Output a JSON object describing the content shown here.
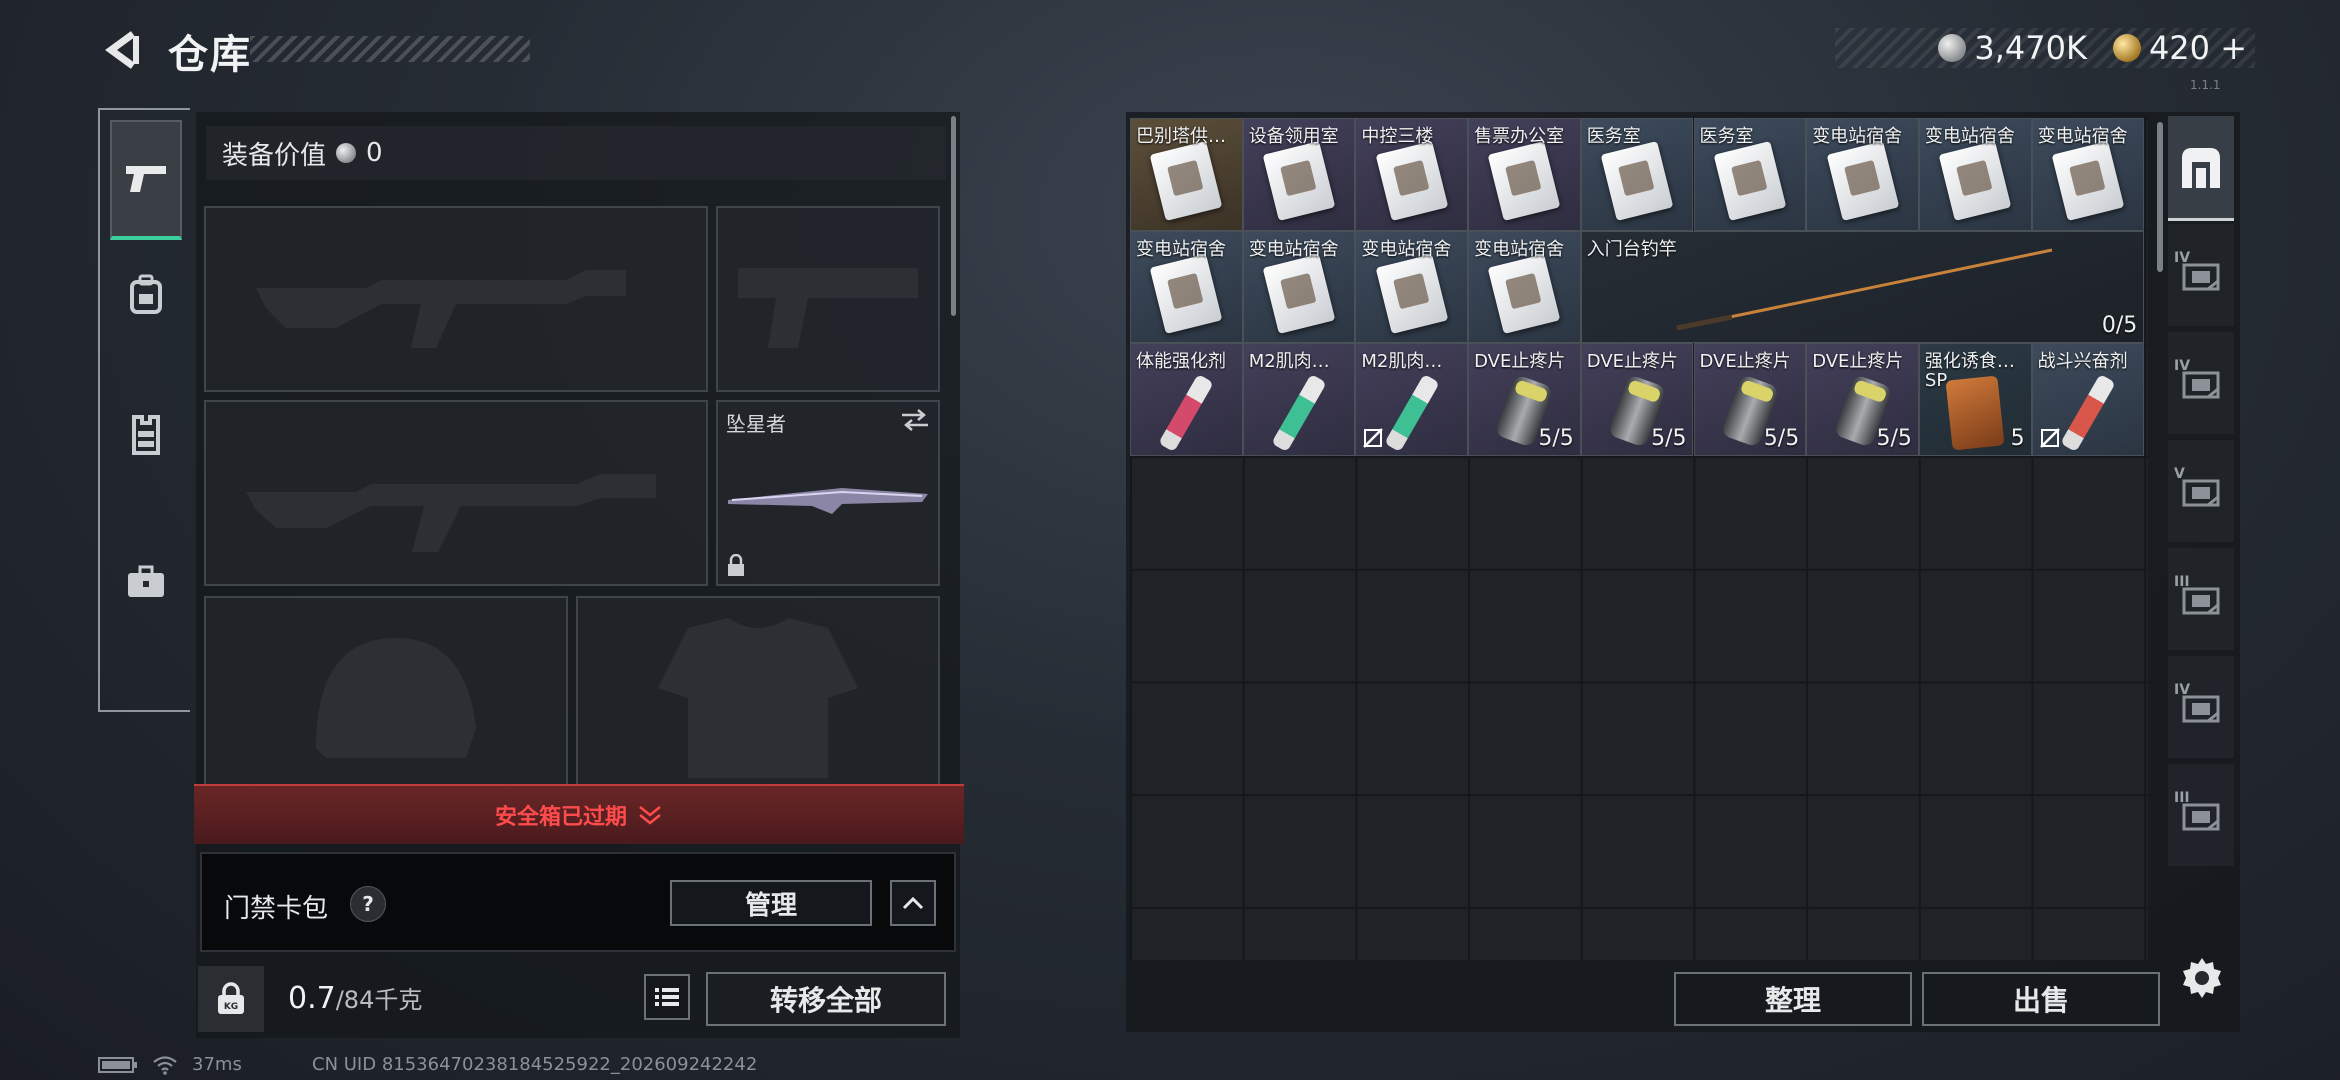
{
  "header": {
    "title": "仓库",
    "version_tag": "1.1.1"
  },
  "currency": [
    {
      "icon": "silver-coin-icon",
      "value": "3,470K"
    },
    {
      "icon": "gold-coin-icon",
      "value": "420 +"
    }
  ],
  "left_nav": [
    {
      "name": "weapons",
      "icon": "pistol-icon",
      "active": true
    },
    {
      "name": "backpack",
      "icon": "backpack-icon",
      "active": false
    },
    {
      "name": "vest",
      "icon": "vest-icon",
      "active": false
    },
    {
      "name": "toolbox",
      "icon": "briefcase-icon",
      "active": false
    }
  ],
  "loadout": {
    "equip_value_label": "装备价值",
    "equip_value": "0",
    "melee_label": "坠星者",
    "safe_box_expired": "安全箱已过期",
    "keycard_label": "门禁卡包",
    "keycard_help": "?",
    "manage_button": "管理",
    "weight_value": "0.7",
    "weight_unit": "/84千克",
    "transfer_all_button": "转移全部"
  },
  "storage": {
    "rows": [
      [
        {
          "name": "巴别塔供…",
          "type": "card",
          "rarity": "gold"
        },
        {
          "name": "设备领用室",
          "type": "card",
          "rarity": "purple"
        },
        {
          "name": "中控三楼",
          "type": "card",
          "rarity": "purple"
        },
        {
          "name": "售票办公室",
          "type": "card",
          "rarity": "purple"
        },
        {
          "name": "医务室",
          "type": "card",
          "rarity": "blue"
        },
        {
          "name": "医务室",
          "type": "card",
          "rarity": "blue"
        },
        {
          "name": "变电站宿舍",
          "type": "card",
          "rarity": "blue"
        },
        {
          "name": "变电站宿舍",
          "type": "card",
          "rarity": "blue"
        },
        {
          "name": "变电站宿舍",
          "type": "card",
          "rarity": "blue"
        }
      ],
      [
        {
          "name": "变电站宿舍",
          "type": "card",
          "rarity": "blue"
        },
        {
          "name": "变电站宿舍",
          "type": "card",
          "rarity": "blue"
        },
        {
          "name": "变电站宿舍",
          "type": "card",
          "rarity": "blue"
        },
        {
          "name": "变电站宿舍",
          "type": "card",
          "rarity": "blue"
        }
      ],
      [
        {
          "name": "体能强化剂",
          "type": "syringe",
          "rarity": "purple",
          "color": "#d44a6a"
        },
        {
          "name": "M2肌肉…",
          "type": "syringe",
          "rarity": "purple",
          "color": "#3fbf94"
        },
        {
          "name": "M2肌肉…",
          "type": "syringe",
          "rarity": "purple",
          "color": "#3fbf94",
          "no_share": true
        },
        {
          "name": "DVE止疼片",
          "type": "pill",
          "rarity": "purple",
          "count": "5/5"
        },
        {
          "name": "DVE止疼片",
          "type": "pill",
          "rarity": "purple",
          "count": "5/5"
        },
        {
          "name": "DVE止疼片",
          "type": "pill",
          "rarity": "purple",
          "count": "5/5"
        },
        {
          "name": "DVE止疼片",
          "type": "pill",
          "rarity": "purple",
          "count": "5/5"
        },
        {
          "name": "强化诱食…",
          "type": "snack",
          "rarity": "darkteal",
          "sub": "SP",
          "count": "5"
        },
        {
          "name": "战斗兴奋剂",
          "type": "syringe",
          "rarity": "blue",
          "color": "#d8574a",
          "no_share": true
        }
      ]
    ],
    "fishing_rod": {
      "name": "入门台钓竿",
      "count": "0/5"
    },
    "sort_button": "整理",
    "sell_button": "出售"
  },
  "right_tabs": [
    {
      "name": "storage-overview",
      "tier": ""
    },
    {
      "name": "tier-iv-cache-1",
      "tier": "IV"
    },
    {
      "name": "tier-iv-cache-2",
      "tier": "IV"
    },
    {
      "name": "tier-v-cache",
      "tier": "V"
    },
    {
      "name": "tier-iii-cache-1",
      "tier": "III"
    },
    {
      "name": "tier-iv-cache-3",
      "tier": "IV"
    },
    {
      "name": "tier-iii-cache-2",
      "tier": "III"
    }
  ],
  "status": {
    "ping": "37ms",
    "uid": "CN UID 81536470238184525922_202609242242"
  }
}
